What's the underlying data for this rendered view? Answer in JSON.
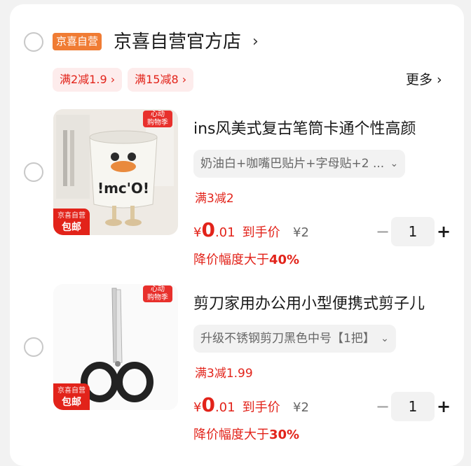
{
  "shop": {
    "badge": "京喜自营",
    "name": "京喜自营官方店",
    "chevron": "›",
    "promos": [
      "满2减1.9",
      "满15减8"
    ],
    "more": "更多 ›"
  },
  "items": [
    {
      "title": "ins风美式复古笔筒卡通个性高颜",
      "spec": "奶油白+咖嘴巴贴片+字母贴+2 ...",
      "discount": "满3减2",
      "currency": "¥",
      "price_int": "0",
      "price_dec": ".01",
      "price_label": "到手价",
      "original_price": "¥2",
      "drop_prefix": "降价幅度大于",
      "drop_value": "40%",
      "quantity": "1",
      "image_icon": "pen-holder-icon",
      "event_tag": "心动\n购物季",
      "self_tag_top": "京喜自营",
      "self_tag_bottom": "包邮",
      "cup_text": "!mc'O!"
    },
    {
      "title": "剪刀家用办公用小型便携式剪子儿",
      "spec": "升级不锈钢剪刀黑色中号【1把】",
      "discount": "满3减1.99",
      "currency": "¥",
      "price_int": "0",
      "price_dec": ".01",
      "price_label": "到手价",
      "original_price": "¥2",
      "drop_prefix": "降价幅度大于",
      "drop_value": "30%",
      "quantity": "1",
      "image_icon": "scissors-icon",
      "event_tag": "心动\n购物季",
      "self_tag_top": "京喜自营",
      "self_tag_bottom": "包邮"
    }
  ],
  "stepper": {
    "minus": "−",
    "plus": "+"
  },
  "spec_chevron": "⌄",
  "colors": {
    "accent": "#e2231a",
    "badge": "#f07c34",
    "tag_bg": "#fdecec"
  }
}
